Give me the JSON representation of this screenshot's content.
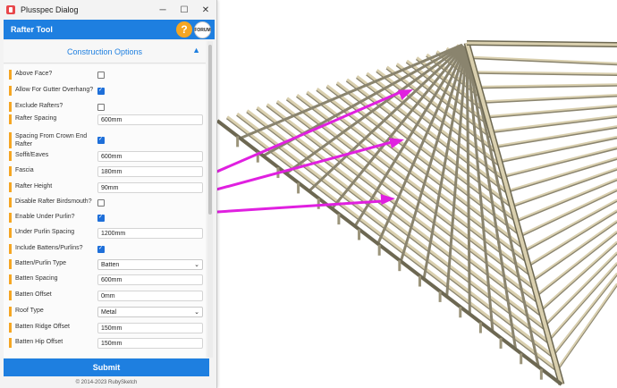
{
  "window": {
    "title": "Plusspec Dialog",
    "minimize_glyph": "─",
    "maximize_glyph": "☐",
    "close_glyph": "✕"
  },
  "header": {
    "title": "Rafter Tool",
    "help_label": "?",
    "forum_label": "FORUM"
  },
  "section": {
    "title": "Construction Options",
    "collapse_glyph": "▲"
  },
  "fields": [
    {
      "label": "Above Face?",
      "type": "checkbox",
      "checked": false
    },
    {
      "label": "Allow For Gutter Overhang?",
      "type": "checkbox",
      "checked": true
    },
    {
      "label": "Exclude Rafters?",
      "type": "checkbox",
      "checked": false
    },
    {
      "label": "Rafter Spacing",
      "type": "text",
      "value": "600mm"
    },
    {
      "label": "Spacing From Crown End Rafter",
      "type": "checkbox",
      "checked": true
    },
    {
      "label": "Soffit/Eaves",
      "type": "text",
      "value": "600mm"
    },
    {
      "label": "Fascia",
      "type": "text",
      "value": "180mm"
    },
    {
      "label": "Rafter Height",
      "type": "text",
      "value": "90mm"
    },
    {
      "label": "Disable Rafter Birdsmouth?",
      "type": "checkbox",
      "checked": false
    },
    {
      "label": "Enable Under Purlin?",
      "type": "checkbox",
      "checked": true
    },
    {
      "label": "Under Purlin Spacing",
      "type": "text",
      "value": "1200mm"
    },
    {
      "label": "Include Battens/Purlins?",
      "type": "checkbox",
      "checked": true
    },
    {
      "label": "Batten/Purlin Type",
      "type": "select",
      "value": "Batten"
    },
    {
      "label": "Batten Spacing",
      "type": "text",
      "value": "600mm"
    },
    {
      "label": "Batten Offset",
      "type": "text",
      "value": "0mm"
    },
    {
      "label": "Roof Type",
      "type": "select",
      "value": "Metal"
    },
    {
      "label": "Batten Ridge Offset",
      "type": "text",
      "value": "150mm"
    },
    {
      "label": "Batten Hip Offset",
      "type": "text",
      "value": "150mm"
    }
  ],
  "submit_label": "Submit",
  "copyright": "© 2014-2023 RubySketch",
  "colors": {
    "accent": "#1e7fe0",
    "label_bar": "#f5a623",
    "annotation": "#e020e0",
    "timber": "#d9cfae"
  }
}
